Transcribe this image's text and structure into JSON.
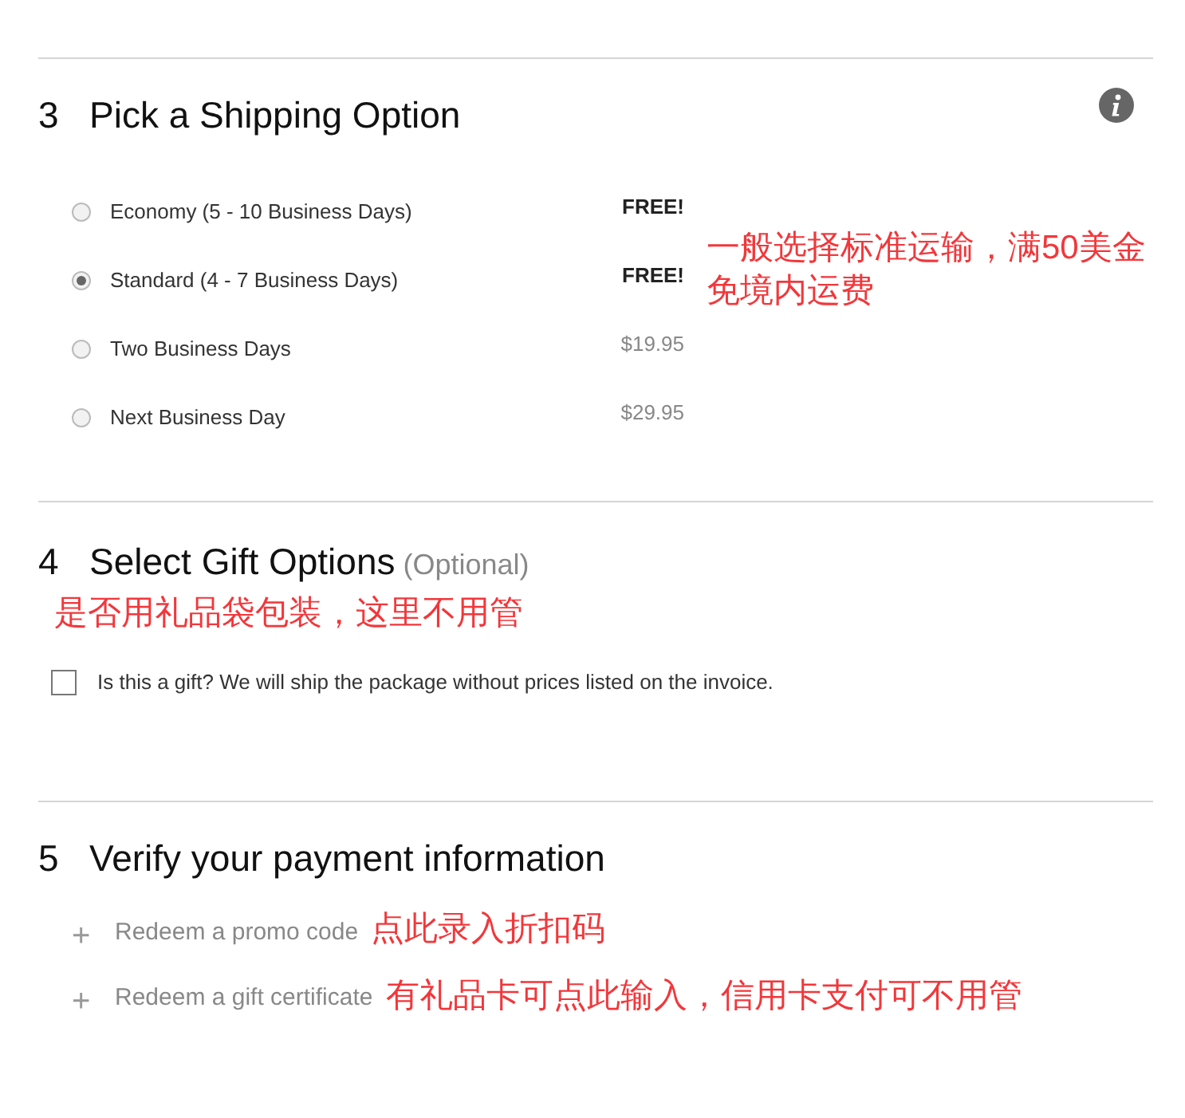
{
  "shipping": {
    "number": "3",
    "title": "Pick a Shipping Option",
    "note": "一般选择标准运输，满50美金免境内运费",
    "options": [
      {
        "label": "Economy (5 - 10 Business Days)",
        "price": "FREE!",
        "kind": "free",
        "selected": false
      },
      {
        "label": "Standard (4 - 7 Business Days)",
        "price": "FREE!",
        "kind": "free",
        "selected": true
      },
      {
        "label": "Two Business Days",
        "price": "$19.95",
        "kind": "paid",
        "selected": false
      },
      {
        "label": "Next Business Day",
        "price": "$29.95",
        "kind": "paid",
        "selected": false
      }
    ]
  },
  "gift": {
    "number": "4",
    "title": "Select Gift Options",
    "optional": "(Optional)",
    "note": "是否用礼品袋包装，这里不用管",
    "checkbox": {
      "label": "Is this a gift? We will ship the package without prices listed on the invoice.",
      "checked": false
    }
  },
  "payment": {
    "number": "5",
    "title": "Verify your payment information",
    "links": [
      {
        "icon": "+",
        "label": "Redeem a promo code",
        "note": "点此录入折扣码"
      },
      {
        "icon": "+",
        "label": "Redeem a gift certificate",
        "note": "有礼品卡可点此输入，信用卡支付可不用管"
      }
    ]
  }
}
